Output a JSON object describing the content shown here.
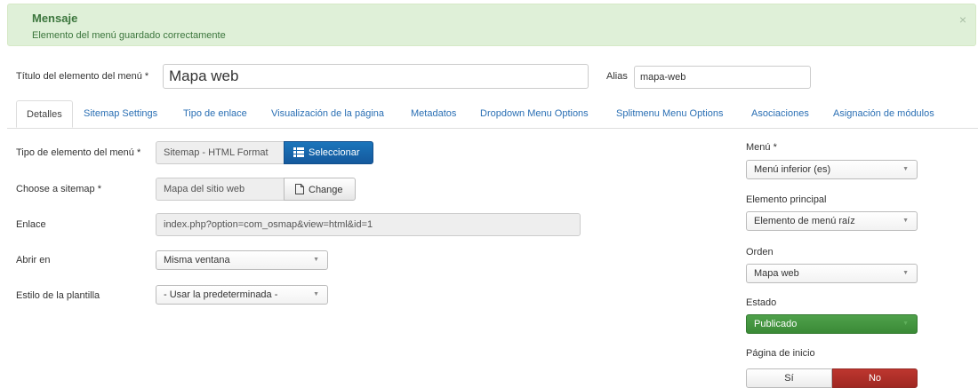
{
  "alert": {
    "title": "Mensaje",
    "message": "Elemento del menú guardado correctamente",
    "close": "×",
    "color": "#dff0d8"
  },
  "header": {
    "title_label": "Título del elemento del menú *",
    "title_value": "Mapa web",
    "alias_label": "Alias",
    "alias_value": "mapa-web"
  },
  "tabs": [
    {
      "label": "Detalles",
      "active": true
    },
    {
      "label": "Sitemap Settings"
    },
    {
      "label": "Tipo de enlace"
    },
    {
      "label": "Visualización de la página"
    },
    {
      "label": "Metadatos"
    },
    {
      "label": "Dropdown Menu Options"
    },
    {
      "label": "Splitmenu Menu Options"
    },
    {
      "label": "Asociaciones"
    },
    {
      "label": "Asignación de módulos"
    }
  ],
  "form": {
    "type_label": "Tipo de elemento del menú *",
    "type_value": "Sitemap - HTML Format",
    "select_button": "Seleccionar",
    "sitemap_label": "Choose a sitemap *",
    "sitemap_value": "Mapa del sitio web",
    "change_button": "Change",
    "link_label": "Enlace",
    "link_value": "index.php?option=com_osmap&view=html&id=1",
    "open_label": "Abrir en",
    "open_value": "Misma ventana",
    "style_label": "Estilo de la plantilla",
    "style_value": "- Usar la predeterminada -"
  },
  "sidebar": {
    "menu_label": "Menú *",
    "menu_value": "Menú inferior (es)",
    "parent_label": "Elemento principal",
    "parent_value": "Elemento de menú raíz",
    "order_label": "Orden",
    "order_value": "Mapa web",
    "status_label": "Estado",
    "status_value": "Publicado",
    "status_color": "#46a546",
    "home_label": "Página de inicio",
    "home_yes": "Sí",
    "home_no": "No",
    "home_no_color": "#bd362f"
  },
  "icons": {
    "select_icon": "list-icon",
    "change_icon": "file-icon",
    "caret": "▼"
  }
}
